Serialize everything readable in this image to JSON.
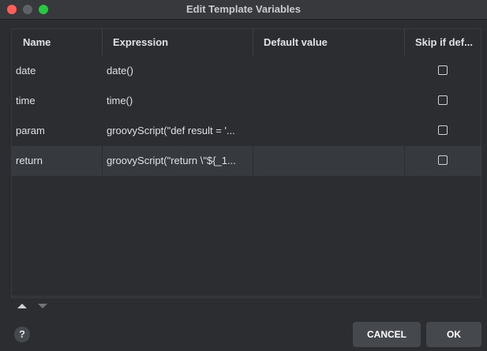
{
  "window": {
    "title": "Edit Template Variables"
  },
  "table": {
    "columns": [
      "Name",
      "Expression",
      "Default value",
      "Skip if def..."
    ],
    "rows": [
      {
        "name": "date",
        "expression": "date()",
        "default": "",
        "skip": false
      },
      {
        "name": "time",
        "expression": "time()",
        "default": "",
        "skip": false
      },
      {
        "name": "param",
        "expression": "groovyScript(\"def result = '...",
        "default": "",
        "skip": false
      },
      {
        "name": "return",
        "expression": "groovyScript(\"return \\\"${_1...",
        "default": "",
        "skip": false,
        "selected": true
      }
    ]
  },
  "toolbar": {
    "move_up_icon": "triangle-up-icon",
    "move_down_icon": "triangle-down-icon"
  },
  "footer": {
    "help_label": "?",
    "cancel_label": "CANCEL",
    "ok_label": "OK"
  },
  "colors": {
    "background": "#2b2d30",
    "selected_row": "#36393e",
    "button": "#45484d"
  }
}
